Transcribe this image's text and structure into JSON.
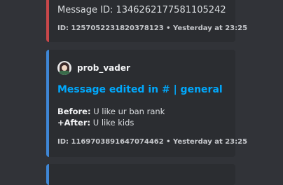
{
  "top_embed": {
    "message_id_line": "Message ID: 1346262177581105242",
    "footer": "ID: 1257052231820378123 • Yesterday at 23:25"
  },
  "edit_embed": {
    "author": "prob_vader",
    "title": "Message edited in # | general",
    "before_label": "Before:",
    "before_text": " U like ur ban rank",
    "after_label": "+After:",
    "after_text": " U like kids",
    "footer": "ID: 1169703891647074462 • Yesterday at 23:25"
  },
  "colors": {
    "background": "#313338",
    "embed": "#2b2d31",
    "top_accent": "#c8474a",
    "edit_accent": "#3f87d6",
    "link": "#00a8fc"
  }
}
